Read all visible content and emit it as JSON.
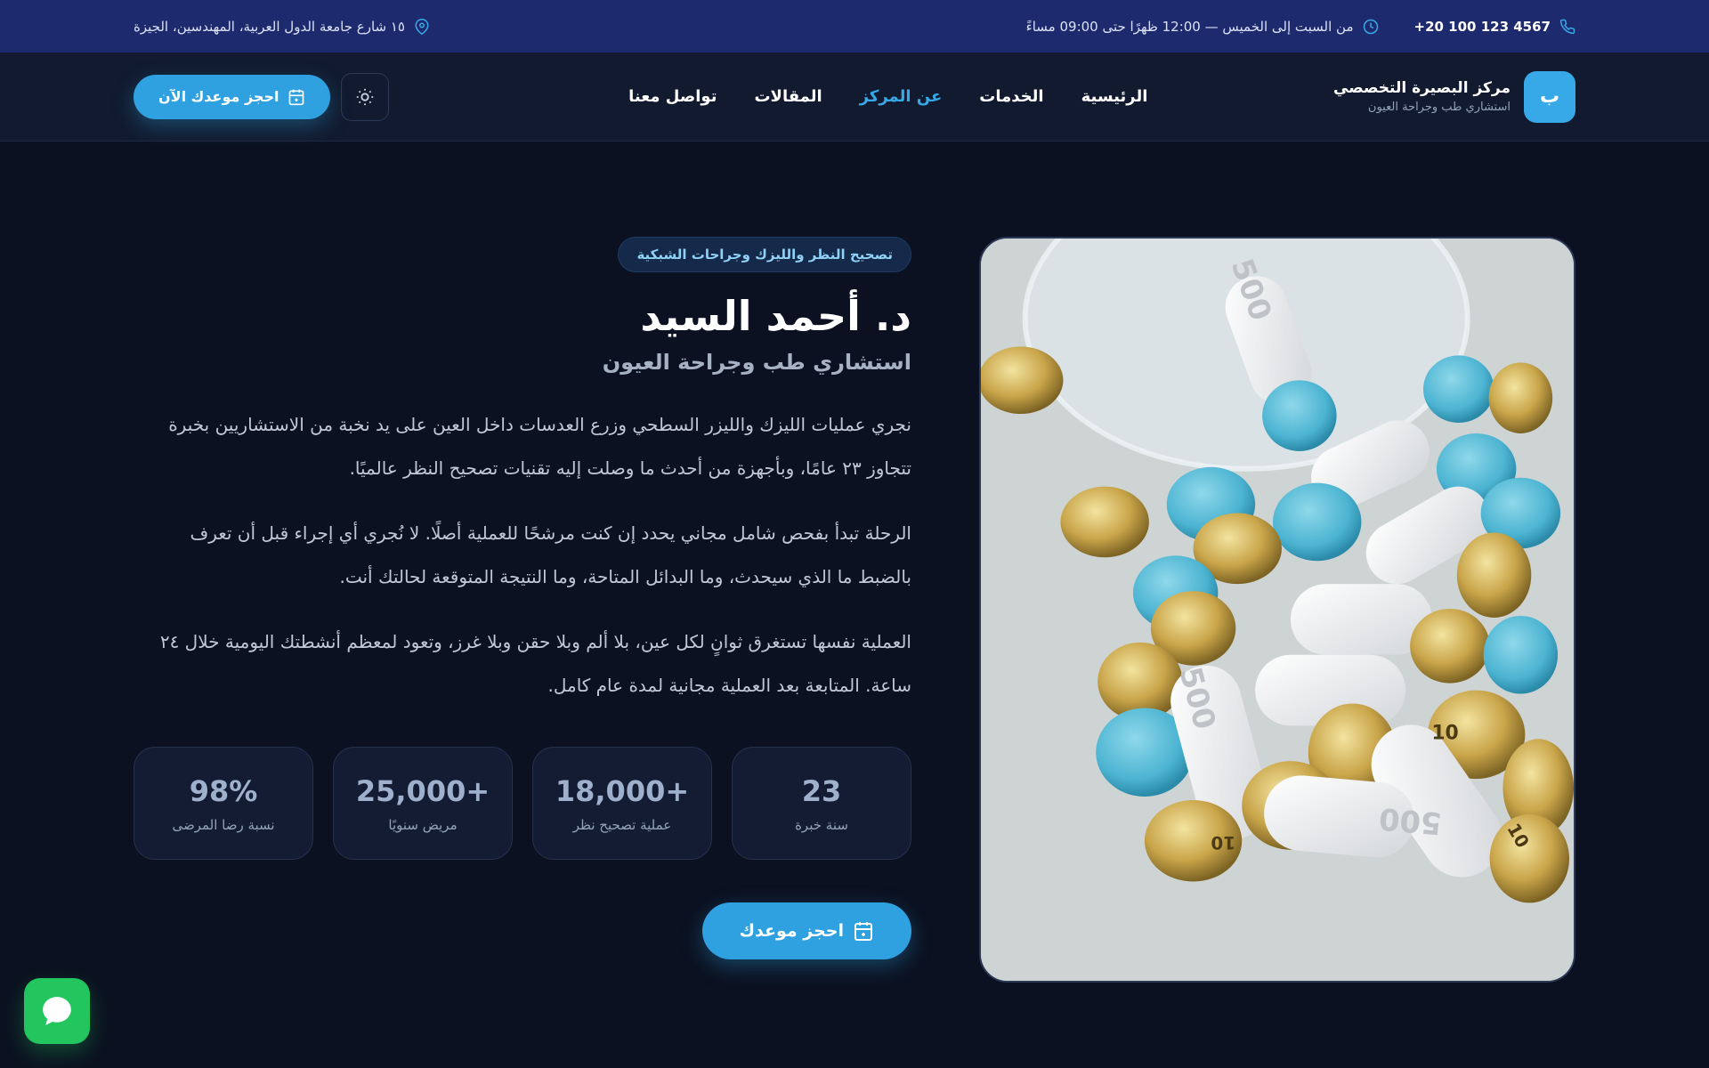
{
  "topbar": {
    "phone": "+20 100 123 4567",
    "hours": "من السبت إلى الخميس — 12:00 ظهرًا حتى 09:00 مساءً",
    "address": "١٥ شارع جامعة الدول العربية، المهندسين، الجيزة"
  },
  "brand": {
    "logo_letter": "ب",
    "name": "مركز البصيرة التخصصي",
    "tagline": "استشاري طب وجراحة العيون"
  },
  "nav": {
    "items": [
      {
        "label": "الرئيسية",
        "active": false
      },
      {
        "label": "الخدمات",
        "active": false
      },
      {
        "label": "عن المركز",
        "active": true
      },
      {
        "label": "المقالات",
        "active": false
      },
      {
        "label": "تواصل معنا",
        "active": false
      }
    ]
  },
  "header": {
    "book_label": "احجز موعدك الآن",
    "theme_icon": "sun-icon"
  },
  "hero": {
    "pill": "تصحيح النظر والليزك وجراحات الشبكية",
    "name": "د. أحمد السيد",
    "title": "استشاري طب وجراحة العيون",
    "paragraphs": [
      "نجري عمليات الليزك والليزر السطحي وزرع العدسات داخل العين على يد نخبة من الاستشاريين بخبرة تتجاوز ٢٣ عامًا، وبأجهزة من أحدث ما وصلت إليه تقنيات تصحيح النظر عالميًا.",
      "الرحلة تبدأ بفحص شامل مجاني يحدد إن كنت مرشحًا للعملية أصلًا. لا نُجري أي إجراء قبل أن تعرف بالضبط ما الذي سيحدث، وما البدائل المتاحة، وما النتيجة المتوقعة لحالتك أنت.",
      "العملية نفسها تستغرق ثوانٍ لكل عين، بلا ألم وبلا حقن وبلا غرز، وتعود لمعظم أنشطتك اليومية خلال ٢٤ ساعة. المتابعة بعد العملية مجانية لمدة عام كامل."
    ],
    "stats": [
      {
        "value": "23",
        "label": "سنة خبرة"
      },
      {
        "value": "18,000+",
        "label": "عملية تصحيح نظر"
      },
      {
        "value": "25,000+",
        "label": "مريض سنويًا"
      },
      {
        "value": "98%",
        "label": "نسبة رضا المرضى"
      }
    ],
    "cta_label": "احجز موعدك",
    "image_pill_marks": [
      "500",
      "500",
      "500",
      "10",
      "10",
      "10"
    ]
  },
  "colors": {
    "accent": "#38a9e8",
    "topbar_bg": "#1e2a6e",
    "page_bg": "#0b1120",
    "chat_green": "#22c55e"
  }
}
